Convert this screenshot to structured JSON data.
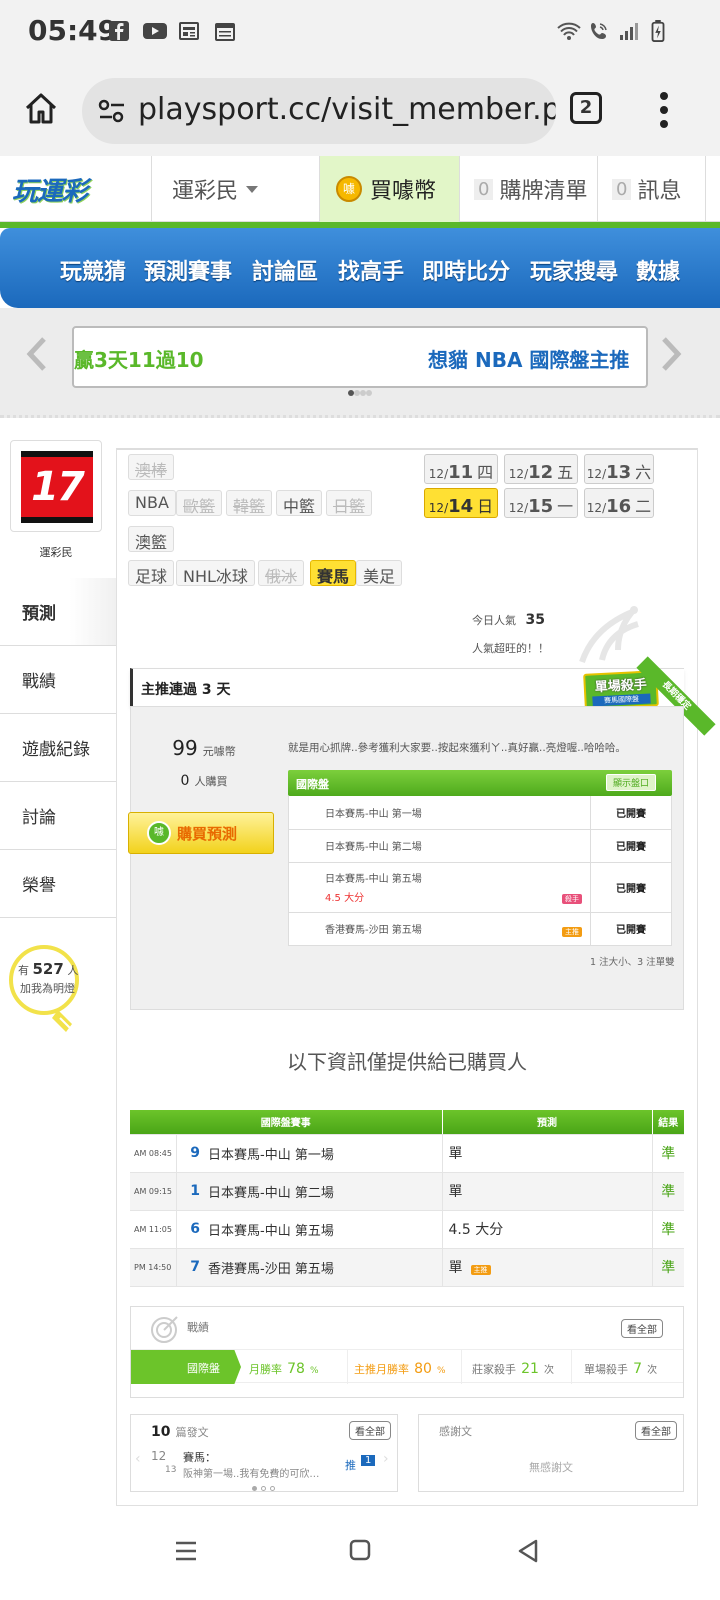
{
  "statusbar": {
    "time": "05:49"
  },
  "browser": {
    "url": "playsport.cc/visit_member.ph",
    "tab_count": "2"
  },
  "site_header": {
    "logo_text": "玩運彩",
    "menu_label": "運彩民",
    "buy_label": "買噱幣",
    "buy_badge": "噱",
    "cart_count": "0",
    "cart_label": "購牌清單",
    "msg_count": "0",
    "msg_label": "訊息"
  },
  "nav": {
    "items": [
      "玩競猜",
      "預測賽事",
      "討論區",
      "找高手",
      "即時比分",
      "玩家搜尋",
      "數據"
    ]
  },
  "carousel": {
    "left_text": "贏3天11過10",
    "right_text": "想貓 NBA 國際盤主推"
  },
  "profile": {
    "avatar_text": "17",
    "name": "運彩民",
    "menu": [
      "預測",
      "戰績",
      "遊戲紀錄",
      "討論",
      "榮譽"
    ],
    "fans_prefix": "有",
    "fans_count": "527",
    "fans_unit": "人",
    "fans_text": "加我為明燈"
  },
  "sports": {
    "row1": [
      "澳棒"
    ],
    "row2": [
      "NBA",
      "歐籃",
      "韓籃",
      "中籃",
      "日籃"
    ],
    "row3": [
      "澳籃"
    ],
    "row4": [
      "足球",
      "NHL冰球",
      "俄冰",
      "賽馬",
      "美足"
    ]
  },
  "dates": [
    {
      "m": "12/",
      "d": "11",
      "w": "四"
    },
    {
      "m": "12/",
      "d": "12",
      "w": "五"
    },
    {
      "m": "12/",
      "d": "13",
      "w": "六"
    },
    {
      "m": "12/",
      "d": "14",
      "w": "日"
    },
    {
      "m": "12/",
      "d": "15",
      "w": "一"
    },
    {
      "m": "12/",
      "d": "16",
      "w": "二"
    }
  ],
  "popularity": {
    "label": "今日人氣",
    "value": "35",
    "note": "人氣超旺的！！"
  },
  "streak": {
    "title": "主推連過 3 天",
    "badge": "單場殺手",
    "badge_sub": "賽馬國際盤",
    "ribbon": "長期穩定"
  },
  "pricing": {
    "price": "99",
    "price_unit": "元噱幣",
    "buyers": "0",
    "buyers_unit": "人購買",
    "buy_button": "購買預測",
    "comment": "就是用心抓牌..參考獲利大家要..按起來獲利ㄚ..真好贏..亮燈喔..哈哈哈。"
  },
  "intl_box": {
    "title": "國際盤",
    "show_button": "顯示盤口",
    "rows": [
      {
        "match": "日本賽馬-中山 第一場",
        "sub": "",
        "tag": "",
        "status": "已開賽"
      },
      {
        "match": "日本賽馬-中山 第二場",
        "sub": "",
        "tag": "",
        "status": "已開賽"
      },
      {
        "match": "日本賽馬-中山 第五場",
        "sub": "4.5 大分",
        "tag": "殺手",
        "status": "已開賽"
      },
      {
        "match": "香港賽馬-沙田 第五場",
        "sub": "",
        "tag": "主推",
        "status": "已開賽"
      }
    ],
    "footnote": "1 注大小、3 注單雙"
  },
  "purchased_note": "以下資訊僅提供給已購買人",
  "results": {
    "headers": [
      "國際盤賽事",
      "預測",
      "結果"
    ],
    "rows": [
      {
        "time": "AM 08:45",
        "num": "9",
        "match": "日本賽馬-中山 第一場",
        "pred": "單",
        "tag": "",
        "result": "準"
      },
      {
        "time": "AM 09:15",
        "num": "1",
        "match": "日本賽馬-中山 第二場",
        "pred": "單",
        "tag": "",
        "result": "準"
      },
      {
        "time": "AM 11:05",
        "num": "6",
        "match": "日本賽馬-中山 第五場",
        "pred": "4.5 大分",
        "tag": "",
        "result": "準"
      },
      {
        "time": "PM 14:50",
        "num": "7",
        "match": "香港賽馬-沙田 第五場",
        "pred": "單",
        "tag": "主推",
        "result": "準"
      }
    ]
  },
  "record": {
    "title": "戰績",
    "see_all": "看全部",
    "tab": "國際盤",
    "month_rate_label": "月勝率",
    "month_rate": "78",
    "main_rate_label": "主推月勝率",
    "main_rate": "80",
    "pct": "%",
    "banker_label": "莊家殺手",
    "banker_count": "21",
    "single_label": "單場殺手",
    "single_count": "7",
    "times": "次"
  },
  "posts": {
    "count": "10",
    "label": "篇發文",
    "see_all": "看全部",
    "date_top": "12",
    "date_bottom": "13",
    "post_title": "賽馬：",
    "post_excerpt": "阪神第一場..我有免費的可欣…",
    "push": "推",
    "push_count": "1"
  },
  "thanks": {
    "label": "感謝文",
    "see_all": "看全部",
    "empty": "無感謝文"
  },
  "colors": {
    "green": "#5ab82a",
    "blue": "#1b69bc",
    "yellow": "#ffe033",
    "orange": "#f39c12"
  }
}
